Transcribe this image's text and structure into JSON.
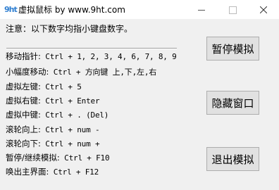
{
  "window": {
    "icon_text": "9ht",
    "title": "虚拟鼠标 by www.9ht.com"
  },
  "note": "注意：以下数字均指小键盘数字。",
  "shortcuts": [
    {
      "label": "移动指针:",
      "keys": " Ctrl + 1, 2, 3, 4, 6, 7, 8, 9"
    },
    {
      "label": "小幅度移动:",
      "keys": " Ctrl + 方向键 上,下,左,右"
    },
    {
      "label": "虚拟左键:",
      "keys": " Ctrl + 5"
    },
    {
      "label": "虚拟右键:",
      "keys": " Ctrl + Enter"
    },
    {
      "label": "虚拟中键:",
      "keys": " Ctrl + . (Del)"
    },
    {
      "label": "滚轮向上:",
      "keys": " Ctrl + num -"
    },
    {
      "label": "滚轮向下:",
      "keys": " Ctrl + num +"
    },
    {
      "label": "暂停/继续模拟:",
      "keys": " Ctrl + F10"
    },
    {
      "label": "唤出主界面:",
      "keys": " Ctrl + F12"
    }
  ],
  "buttons": {
    "pause": "暂停模拟",
    "hide": "隐藏窗口",
    "exit": "退出模拟"
  },
  "colors": {
    "icon_accent": "#2f7fd1",
    "focus_border": "#0078d7",
    "client_bg": "#f0f0f0"
  }
}
